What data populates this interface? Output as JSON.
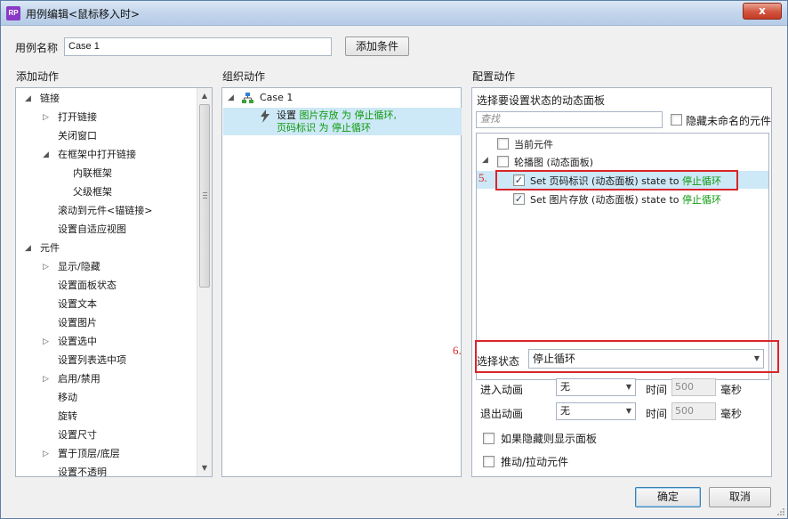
{
  "window": {
    "title": "用例编辑<鼠标移入时>",
    "app_icon": "RP",
    "close": "x"
  },
  "case_name": {
    "label": "用例名称",
    "value": "Case 1"
  },
  "add_condition": "添加条件",
  "sections": {
    "add_action": "添加动作",
    "organize_action": "组织动作",
    "configure_action": "配置动作"
  },
  "actions_tree": [
    {
      "label": "链接",
      "level": 0,
      "expander": "open"
    },
    {
      "label": "打开链接",
      "level": 1,
      "expander": "closed"
    },
    {
      "label": "关闭窗口",
      "level": 1,
      "expander": "none"
    },
    {
      "label": "在框架中打开链接",
      "level": 1,
      "expander": "open"
    },
    {
      "label": "内联框架",
      "level": 2,
      "expander": "none"
    },
    {
      "label": "父级框架",
      "level": 2,
      "expander": "none"
    },
    {
      "label": "滚动到元件<锚链接>",
      "level": 1,
      "expander": "none"
    },
    {
      "label": "设置自适应视图",
      "level": 1,
      "expander": "none"
    },
    {
      "label": "元件",
      "level": 0,
      "expander": "open"
    },
    {
      "label": "显示/隐藏",
      "level": 1,
      "expander": "closed"
    },
    {
      "label": "设置面板状态",
      "level": 1,
      "expander": "none"
    },
    {
      "label": "设置文本",
      "level": 1,
      "expander": "none"
    },
    {
      "label": "设置图片",
      "level": 1,
      "expander": "none"
    },
    {
      "label": "设置选中",
      "level": 1,
      "expander": "closed"
    },
    {
      "label": "设置列表选中项",
      "level": 1,
      "expander": "none"
    },
    {
      "label": "启用/禁用",
      "level": 1,
      "expander": "closed"
    },
    {
      "label": "移动",
      "level": 1,
      "expander": "none"
    },
    {
      "label": "旋转",
      "level": 1,
      "expander": "none"
    },
    {
      "label": "设置尺寸",
      "level": 1,
      "expander": "none"
    },
    {
      "label": "置于顶层/底层",
      "level": 1,
      "expander": "closed"
    },
    {
      "label": "设置不透明",
      "level": 1,
      "expander": "none"
    }
  ],
  "organize": {
    "case_label": "Case 1",
    "action": {
      "prefix": "设置",
      "panel1": "图片存放",
      "word_to1": "为",
      "state1": "停止循环,",
      "panel2": "页码标识",
      "word_to2": "为",
      "state2": "停止循环"
    }
  },
  "configure": {
    "prompt": "选择要设置状态的动态面板",
    "search_placeholder": "查找",
    "hide_unnamed": "隐藏未命名的元件",
    "current_element": "当前元件",
    "carousel": "轮播图 (动态面板)",
    "item1": {
      "text": "Set 页码标识 (动态面板) state to ",
      "state": "停止循环",
      "checked": "✓"
    },
    "item2": {
      "text": "Set 图片存放 (动态面板) state to ",
      "state": "停止循环",
      "checked": "✓"
    },
    "annotation5": "5.",
    "annotation6": "6.",
    "select_state_label": "选择状态",
    "select_state_value": "停止循环",
    "enter_anim_label": "进入动画",
    "enter_anim_value": "无",
    "exit_anim_label": "退出动画",
    "exit_anim_value": "无",
    "time_label": "时间",
    "time_value": "500",
    "ms_label": "毫秒",
    "show_if_hidden": "如果隐藏则显示面板",
    "push_pull": "推动/拉动元件"
  },
  "footer": {
    "ok": "确定",
    "cancel": "取消"
  },
  "colors": {
    "accent_green": "#0f9a0f",
    "highlight": "#cde8f6",
    "annotation_red": "#d9262a"
  }
}
